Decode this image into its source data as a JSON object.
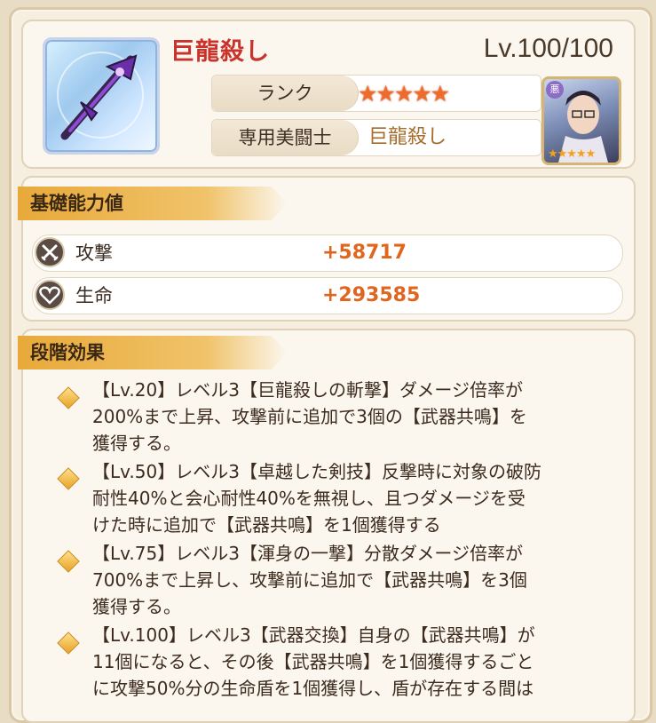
{
  "weapon": {
    "name": "巨龍殺し",
    "level": "Lv.100/100",
    "rank_label": "ランク",
    "rank_stars": "★★★★★",
    "exclusive_label": "専用美闘士",
    "exclusive_value": "巨龍殺し",
    "portrait_stars": "★★★★★",
    "portrait_badge": "悪"
  },
  "base_stats": {
    "title": "基礎能力値",
    "rows": [
      {
        "label": "攻撃",
        "value": "+58717",
        "icon": "crossed-swords-icon"
      },
      {
        "label": "生命",
        "value": "+293585",
        "icon": "heart-icon"
      }
    ]
  },
  "stage_effects": {
    "title": "段階効果",
    "items": [
      "【Lv.20】レベル3【巨龍殺しの斬撃】ダメージ倍率が\n200%まで上昇、攻撃前に追加で3個の【武器共鳴】を\n獲得する。",
      "【Lv.50】レベル3【卓越した剣技】反撃時に対象の破防\n耐性40%と会心耐性40%を無視し、且つダメージを受\nけた時に追加で【武器共鳴】を1個獲得する",
      "【Lv.75】レベル3【渾身の一撃】分散ダメージ倍率が\n700%まで上昇し、攻撃前に追加で【武器共鳴】を3個\n獲得する。",
      "【Lv.100】レベル3【武器交換】自身の【武器共鳴】が\n11個になると、その後【武器共鳴】を1個獲得するごと\nに攻撃50%分の生命盾を1個獲得し、盾が存在する間は"
    ]
  },
  "colors": {
    "accent_red": "#c9332b",
    "stat_orange": "#e0651f",
    "star_orange": "#ef6b2a",
    "tab_gold": "#e8a93a"
  }
}
